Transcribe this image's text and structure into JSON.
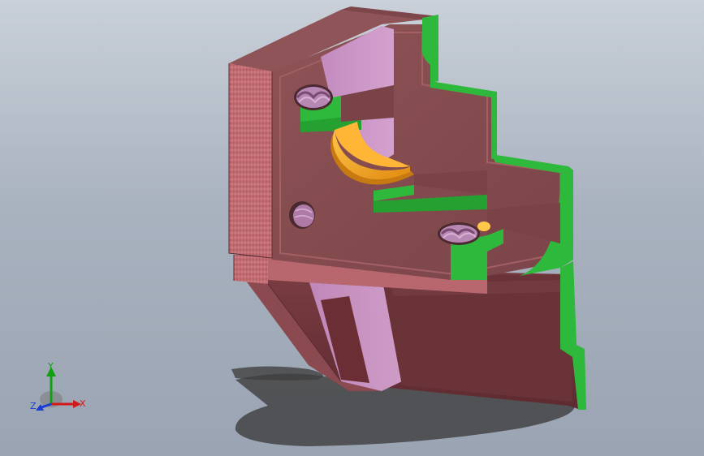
{
  "viewport": {
    "background_top": "#c9d0d9",
    "background_bottom": "#9aa4b2"
  },
  "model": {
    "colors": {
      "body": "#8a4f52",
      "body_dark": "#6e3b3f",
      "side_texture": "#c26a72",
      "section_cut": "#2eb83c",
      "pink_face": "#c994c5",
      "bore": "#f2a52a"
    }
  },
  "triad": {
    "x_label": "X",
    "y_label": "Y",
    "z_label": "Z",
    "x_color": "#d11a1a",
    "y_color": "#12a012",
    "z_color": "#1a3cd0"
  }
}
